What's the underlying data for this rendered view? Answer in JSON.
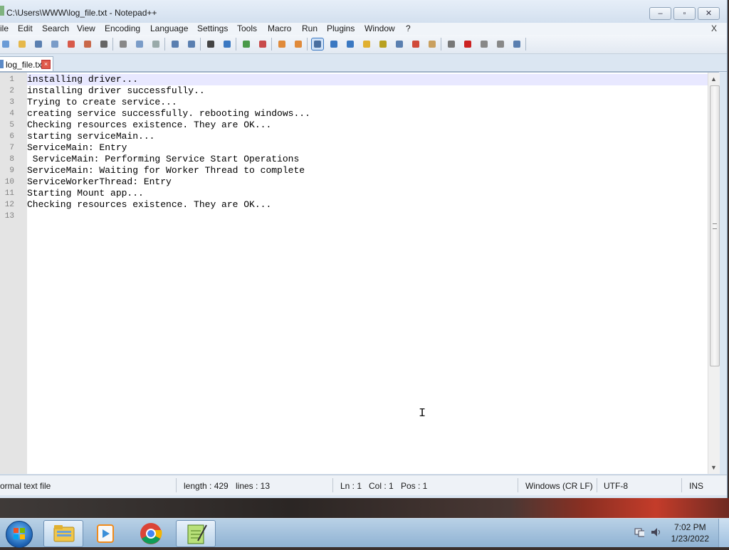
{
  "window": {
    "title": "C:\\Users\\WWW\\log_file.txt - Notepad++",
    "min_glyph": "–",
    "max_glyph": "▫",
    "close_glyph": "✕"
  },
  "menu": {
    "items": [
      "ile",
      "Edit",
      "Search",
      "View",
      "Encoding",
      "Language",
      "Settings",
      "Tools",
      "Macro",
      "Run",
      "Plugins",
      "Window",
      "?"
    ],
    "close_doc": "X"
  },
  "toolbar": {
    "icons": [
      "new-file-icon",
      "open-file-icon",
      "save-icon",
      "save-all-icon",
      "close-icon",
      "close-all-icon",
      "print-icon",
      "cut-icon",
      "copy-icon",
      "paste-icon",
      "undo-icon",
      "redo-icon",
      "find-icon",
      "replace-icon",
      "zoom-in-icon",
      "zoom-out-icon",
      "sync-vertical-icon",
      "sync-horizontal-icon",
      "word-wrap-icon",
      "show-all-chars-icon",
      "indent-guide-icon",
      "user-lang-icon",
      "doc-map-icon",
      "function-list-icon",
      "folder-workspace-icon",
      "monitor-icon",
      "record-macro-icon",
      "stop-macro-icon",
      "play-macro-icon",
      "run-macro-multiple-icon",
      "save-macro-icon"
    ]
  },
  "tab": {
    "label": "log_file.txt"
  },
  "editor": {
    "lines": [
      "installing driver...",
      "installing driver successfully..",
      "Trying to create service...",
      "creating service successfully. rebooting windows...",
      "Checking resources existence. They are OK...",
      "starting serviceMain...",
      "ServiceMain: Entry",
      " ServiceMain: Performing Service Start Operations",
      "ServiceMain: Waiting for Worker Thread to complete",
      "ServiceWorkerThread: Entry",
      "Starting Mount app...",
      "Checking resources existence. They are OK...",
      ""
    ],
    "line_numbers": [
      "1",
      "2",
      "3",
      "4",
      "5",
      "6",
      "7",
      "8",
      "9",
      "10",
      "11",
      "12",
      "13"
    ],
    "cursor_glyph": "I"
  },
  "status": {
    "file_type": "ormal text file",
    "length": "length : 429",
    "lines": "lines : 13",
    "ln": "Ln : 1",
    "col": "Col : 1",
    "pos": "Pos : 1",
    "eol": "Windows (CR LF)",
    "encoding": "UTF-8",
    "mode": "INS"
  },
  "taskbar": {
    "apps": [
      "file-explorer-icon",
      "media-player-icon",
      "chrome-icon",
      "notepadpp-icon"
    ],
    "time": "7:02 PM",
    "date": "1/23/2022"
  },
  "colors": {
    "current_line": "#e8e8ff",
    "gutter": "#e4e4e4",
    "accent": "#3a78c2"
  }
}
